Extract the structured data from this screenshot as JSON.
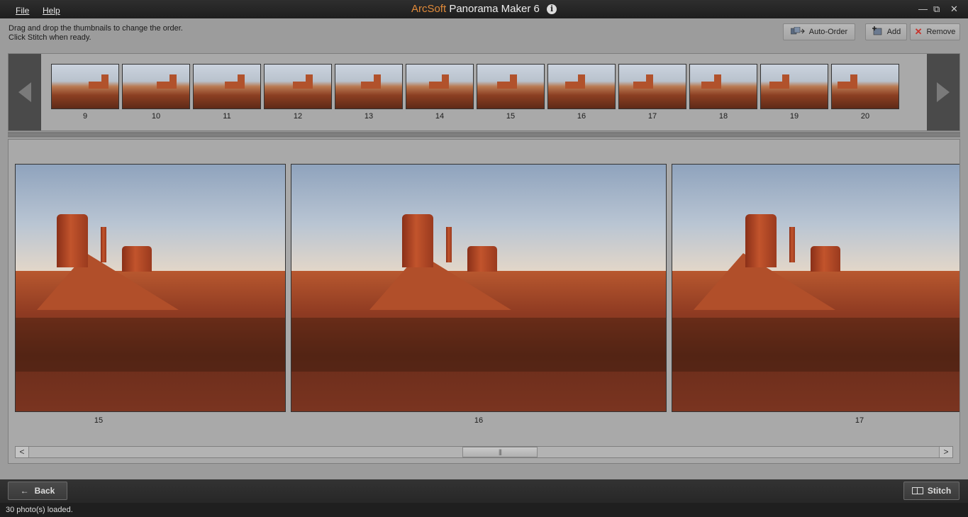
{
  "titlebar": {
    "brand": "ArcSoft",
    "title": "Panorama Maker 6",
    "info_glyph": "i",
    "menu": [
      {
        "label": "File"
      },
      {
        "label": "Help"
      }
    ],
    "controls": {
      "minimize": "—",
      "maximize": "⧉",
      "close": "✕"
    }
  },
  "toolbar": {
    "instruction_line1": "Drag and drop the thumbnails to change the order.",
    "instruction_line2": "Click Stitch when ready.",
    "auto_order_label": "Auto-Order",
    "add_label": "Add",
    "remove_label": "Remove",
    "auto_order_icon": "auto-order-icon",
    "add_icon": "add-photo-icon",
    "remove_icon": "remove-x-icon"
  },
  "filmstrip": {
    "thumbnails": [
      {
        "number": "9"
      },
      {
        "number": "10"
      },
      {
        "number": "11"
      },
      {
        "number": "12"
      },
      {
        "number": "13"
      },
      {
        "number": "14"
      },
      {
        "number": "15"
      },
      {
        "number": "16"
      },
      {
        "number": "17"
      },
      {
        "number": "18"
      },
      {
        "number": "19"
      },
      {
        "number": "20"
      }
    ]
  },
  "preview": {
    "photos": [
      {
        "number": "15"
      },
      {
        "number": "16"
      },
      {
        "number": "17"
      }
    ],
    "scroll_grip": "|||",
    "scroll_left": "<",
    "scroll_right": ">"
  },
  "bottom": {
    "back_label": "Back",
    "stitch_label": "Stitch",
    "back_glyph": "←"
  },
  "status": {
    "text": "30 photo(s) loaded."
  }
}
